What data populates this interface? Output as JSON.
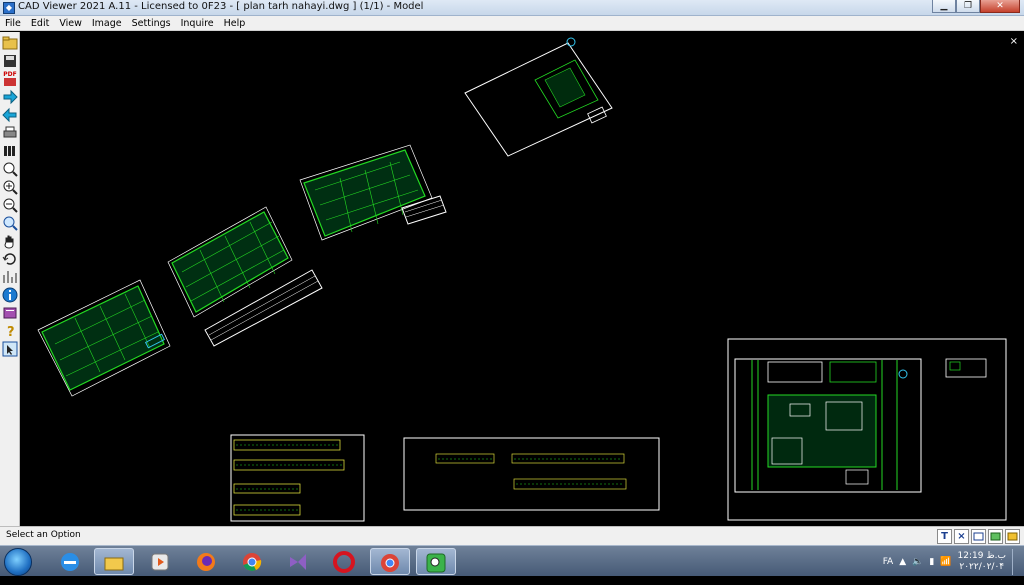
{
  "window": {
    "title": "CAD Viewer 2021 A.11 - Licensed to 0F23  -  [ plan tarh nahayi.dwg ] (1/1)  -  Model",
    "minimize": "▁",
    "maximize": "❐",
    "close": "✕"
  },
  "menu": [
    "File",
    "Edit",
    "View",
    "Image",
    "Settings",
    "Inquire",
    "Help"
  ],
  "toolbar": {
    "pdf_label": "PDF"
  },
  "canvas": {
    "close_doc": "×"
  },
  "status": {
    "text": "Select an Option",
    "buttons": [
      "T",
      "×",
      "",
      "",
      ""
    ]
  },
  "taskbar": {
    "lang": "FA",
    "time": "12:19 ب.ظ",
    "date": "۲۰۲۲/۰۲/۰۴"
  },
  "colors": {
    "title_bg": "#c7d7ea",
    "canvas_bg": "#000000",
    "drawing_line": "#23d923",
    "frame_line": "#ffffff",
    "accent_cyan": "#33c6f0"
  }
}
